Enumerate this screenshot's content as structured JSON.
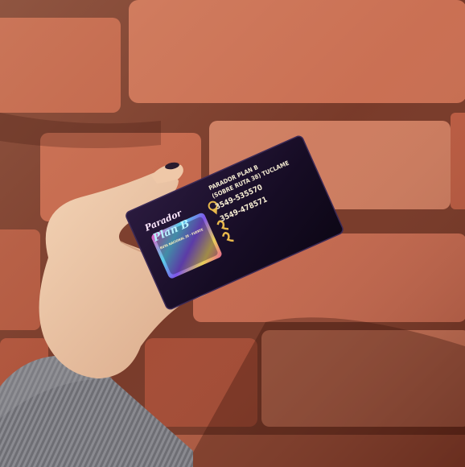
{
  "photo": {
    "subject": "hand holding business card against brick wall",
    "colors": {
      "brick": "#b4523a",
      "brick_light": "#d98a6a",
      "mortar": "#6e2b1d",
      "card": "#1a0f2a",
      "card_text": "#f5ecd2",
      "skin": "#e9c3a3",
      "nail": "#2a1c2e",
      "sleeve": "#6f6f74"
    }
  },
  "card": {
    "logo_line1": "Parador",
    "logo_line2": "Plan B",
    "logo_sub": "RUTA NACIONAL 38 · FUERTE",
    "address_line1": "PARADOR PLAN B",
    "address_line2": "(SOBRE RUTA 38) TUCLAME",
    "phone1": "3549-535570",
    "phone2": "3549-478571",
    "icons": [
      "location-pin-icon",
      "phone-icon",
      "phone-icon"
    ]
  }
}
